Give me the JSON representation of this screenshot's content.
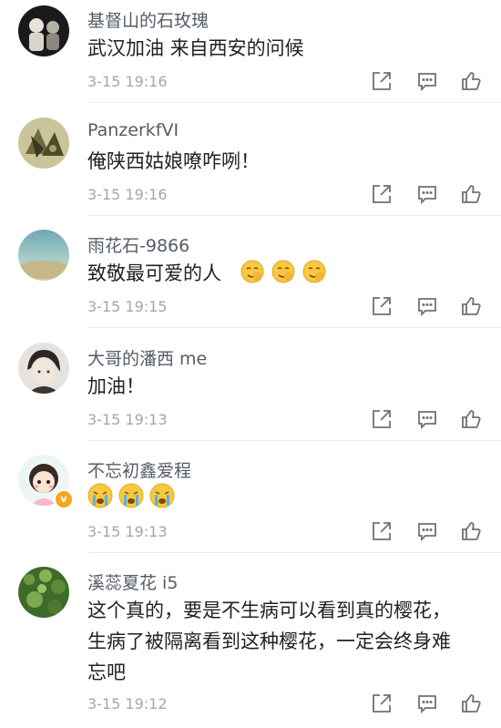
{
  "comments": [
    {
      "username": "基督山的石玫瑰",
      "lines": [
        "武汉加油 来自西安的问候"
      ],
      "time": "3-15 19:16",
      "avatar_icon": "black-white-figures-avatar"
    },
    {
      "username": "PanzerkfVI",
      "lines": [
        "俺陕西姑娘嘹咋咧！"
      ],
      "time": "3-15 19:16",
      "avatar_icon": "military-insignia-avatar"
    },
    {
      "username": "雨花石-9866",
      "lines": [
        "致敬最可爱的人"
      ],
      "time": "3-15 19:15",
      "avatar_icon": "blue-landscape-avatar",
      "emoji": [
        "salute-face-emoji",
        "salute-face-emoji",
        "salute-face-emoji"
      ]
    },
    {
      "username": "大哥的潘西 me",
      "lines": [
        "加油！"
      ],
      "time": "3-15 19:13",
      "avatar_icon": "anime-portrait-avatar"
    },
    {
      "username": "不忘初鑫爱程",
      "lines": [],
      "time": "3-15 19:13",
      "avatar_icon": "cartoon-girl-avatar",
      "verified_badge": "v",
      "emoji": [
        "crying-face-emoji",
        "crying-face-emoji",
        "crying-face-emoji"
      ]
    },
    {
      "username": "溪蕊夏花 i5",
      "lines": [
        "这个真的，要是不生病可以看到真的樱花，",
        "生病了被隔离看到这种樱花，一定会终身难",
        "忘吧"
      ],
      "time": "3-15 19:12",
      "avatar_icon": "green-plant-avatar"
    }
  ],
  "actions": [
    "forward-icon",
    "comment-icon",
    "like-icon"
  ],
  "colors": {
    "username": "#555c66",
    "time": "#a3a7ad",
    "text": "#222222"
  }
}
